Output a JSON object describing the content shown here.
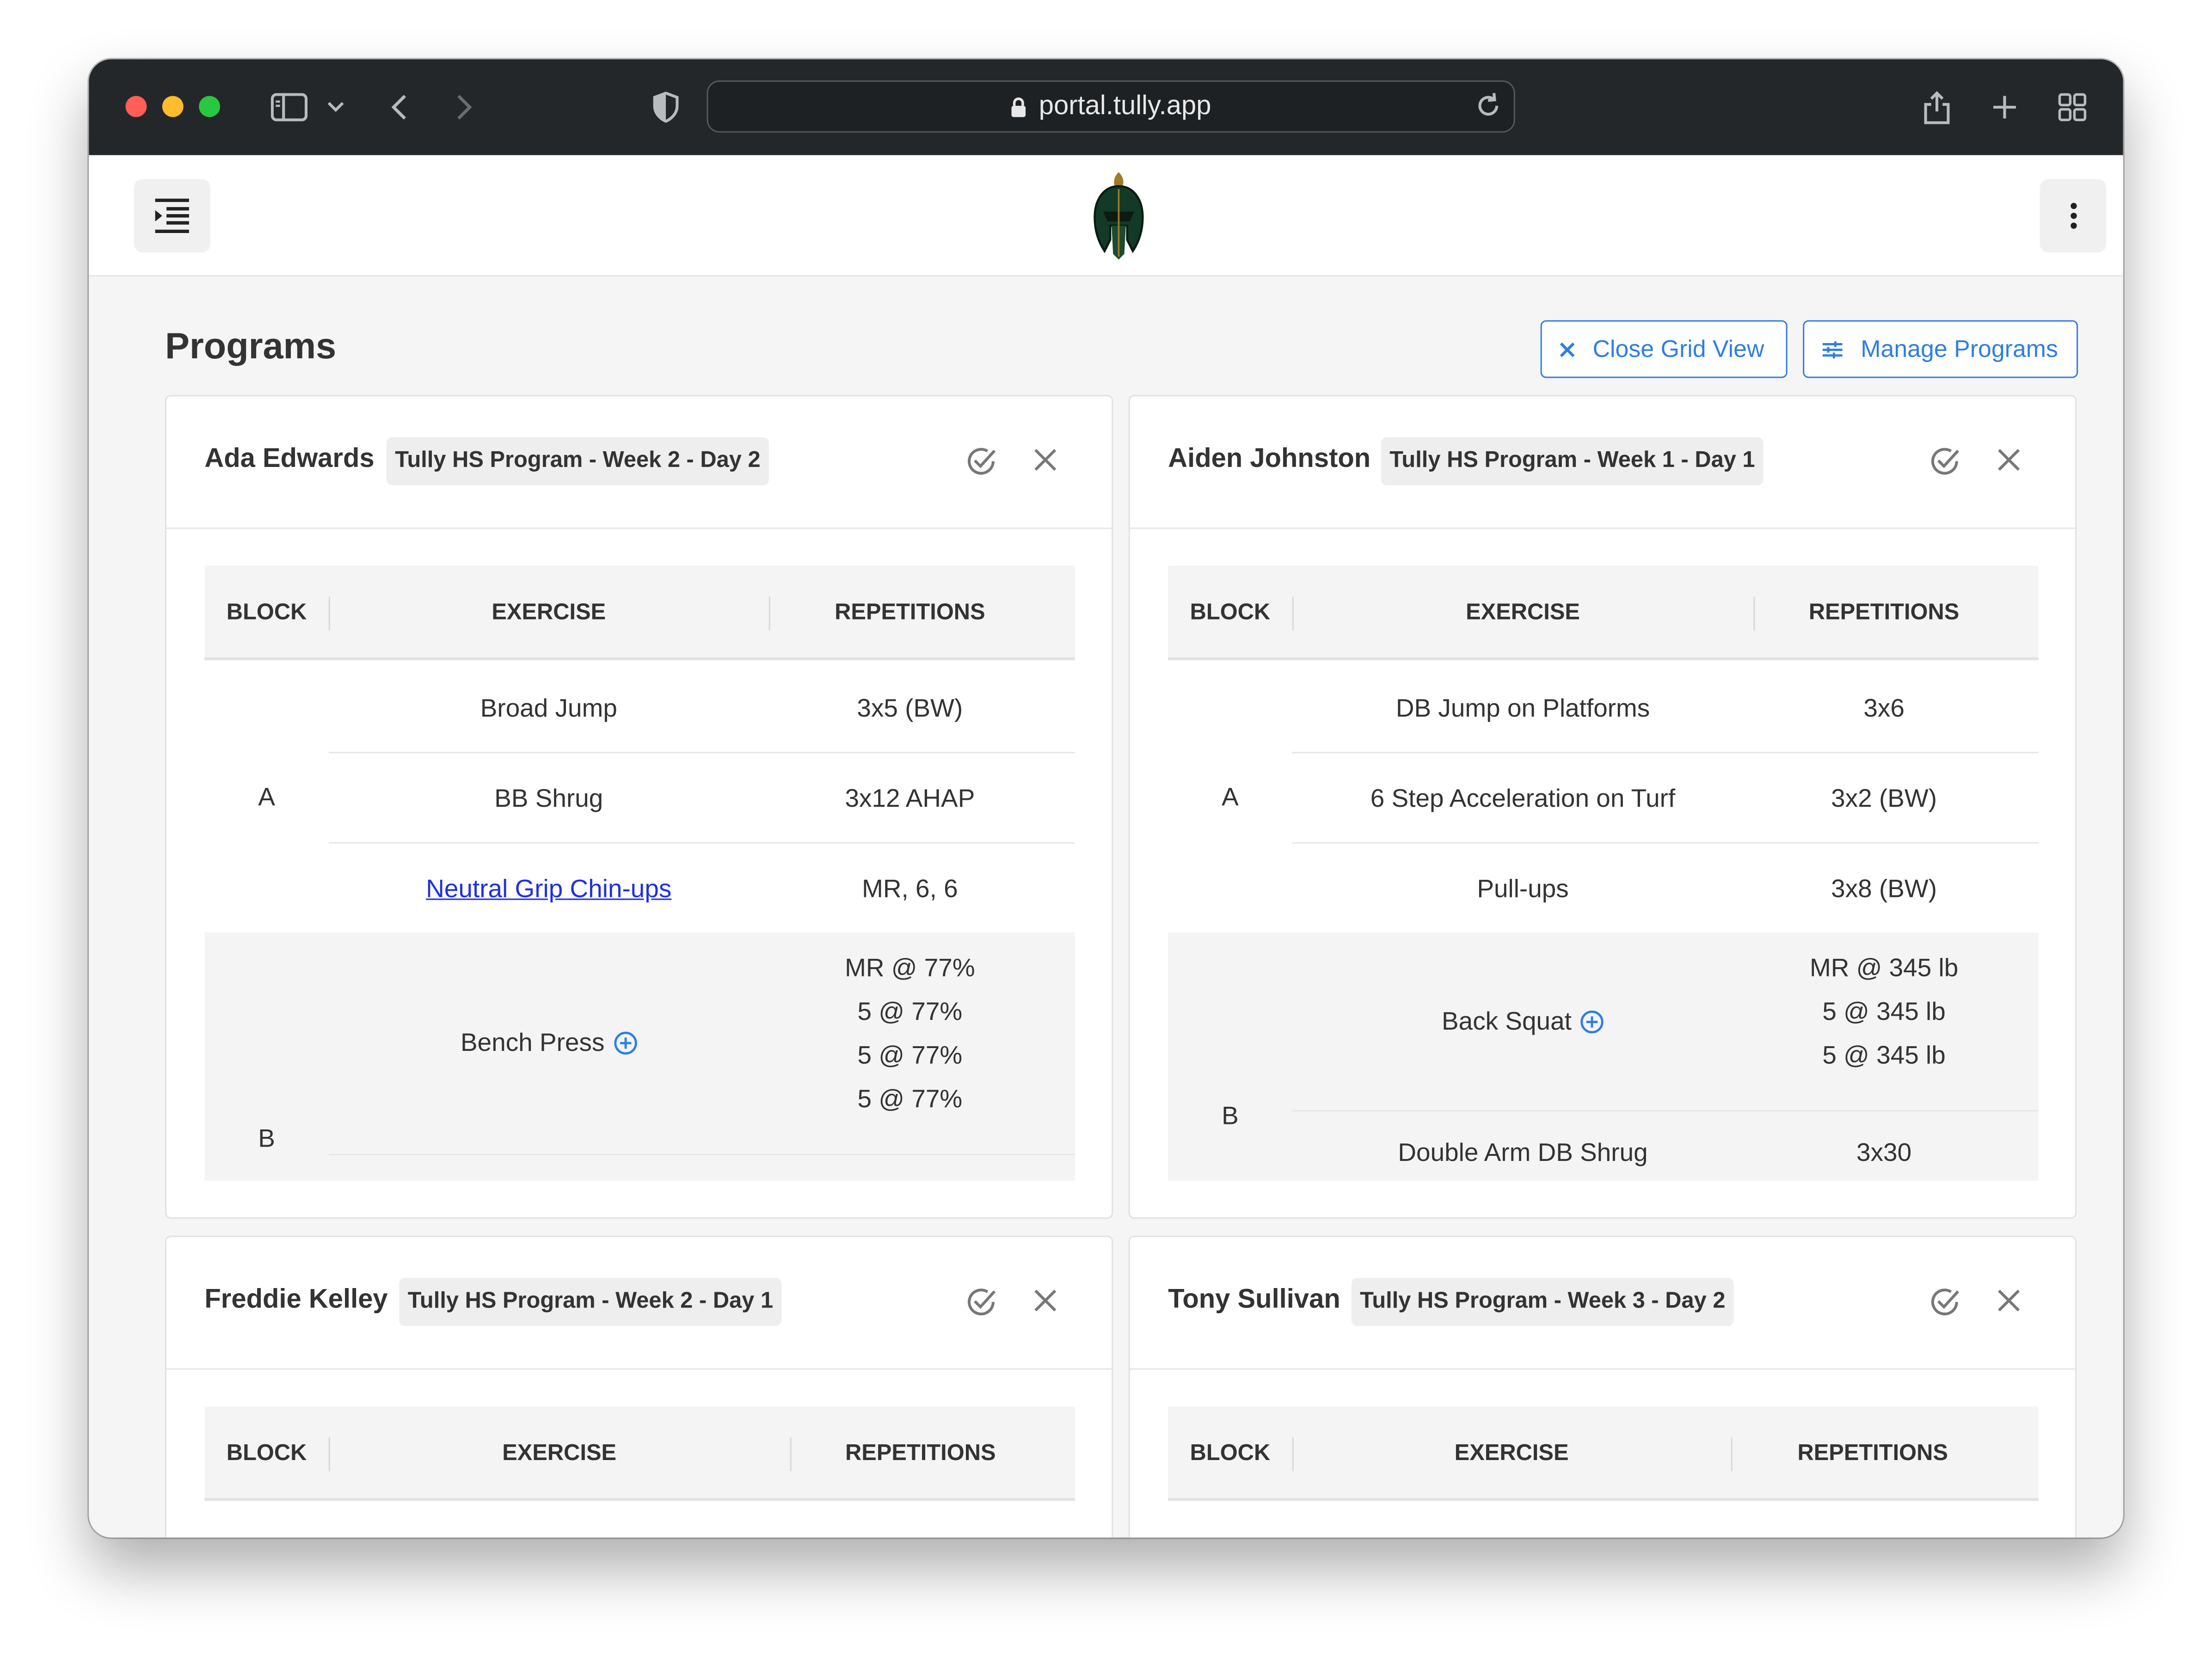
{
  "browser": {
    "url": "portal.tully.app"
  },
  "page": {
    "title": "Programs",
    "close_grid_label": "Close Grid View",
    "manage_label": "Manage Programs"
  },
  "table_headers": {
    "block": "BLOCK",
    "exercise": "EXERCISE",
    "repetitions": "REPETITIONS"
  },
  "cards": [
    {
      "athlete": "Ada Edwards",
      "program": "Tully HS Program - Week 2 - Day 2",
      "block_a": "A",
      "block_b": "B",
      "rows_a": [
        {
          "exercise": "Broad Jump",
          "reps": "3x5 (BW)"
        },
        {
          "exercise": "BB Shrug",
          "reps": "3x12 AHAP"
        },
        {
          "exercise": "Neutral Grip Chin-ups",
          "reps": "MR, 6, 6"
        }
      ],
      "row_b": {
        "exercise": "Bench Press",
        "reps": [
          "MR @ 77%",
          "5 @ 77%",
          "5 @ 77%",
          "5 @ 77%"
        ]
      }
    },
    {
      "athlete": "Aiden Johnston",
      "program": "Tully HS Program - Week 1 - Day 1",
      "block_a": "A",
      "block_b": "B",
      "rows_a": [
        {
          "exercise": "DB Jump on Platforms",
          "reps": "3x6"
        },
        {
          "exercise": "6 Step Acceleration on Turf",
          "reps": "3x2 (BW)"
        },
        {
          "exercise": "Pull-ups",
          "reps": "3x8 (BW)"
        }
      ],
      "row_b": {
        "exercise": "Back Squat",
        "reps": [
          "MR @ 345 lb",
          "5 @ 345 lb",
          "5 @ 345 lb"
        ]
      },
      "row_b2": {
        "exercise": "Double Arm DB Shrug",
        "reps": "3x30"
      }
    },
    {
      "athlete": "Freddie Kelley",
      "program": "Tully HS Program - Week 2 - Day 1"
    },
    {
      "athlete": "Tony Sullivan",
      "program": "Tully HS Program - Week 3 - Day 2"
    }
  ],
  "colors": {
    "accent": "#2f7ee0",
    "link": "#1f2fe0",
    "titlebar": "#24272a"
  }
}
